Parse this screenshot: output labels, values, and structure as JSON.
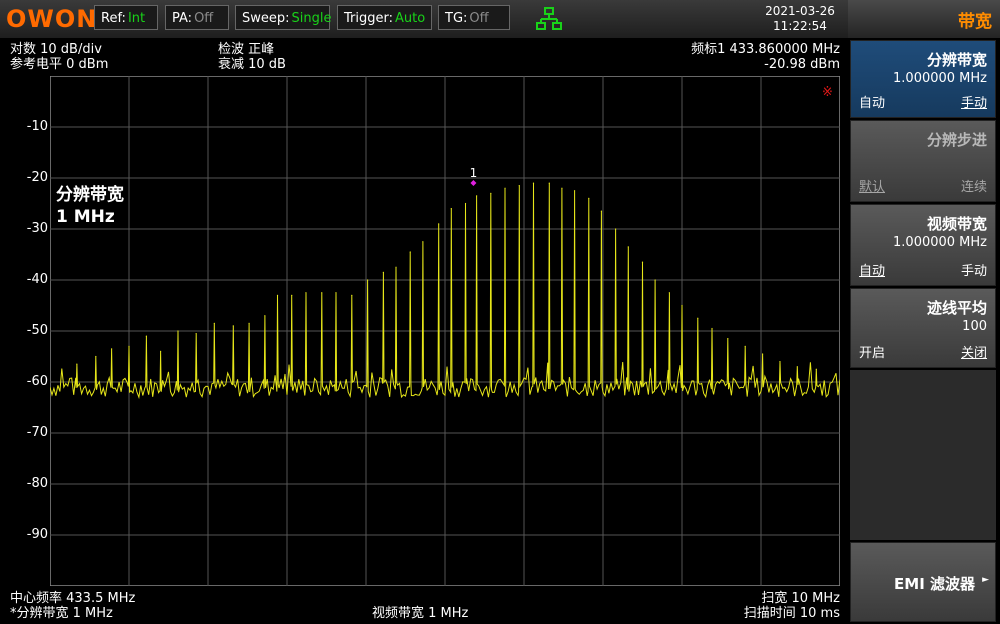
{
  "topbar": {
    "logo": "OWON",
    "ref_key": "Ref:",
    "ref_val": "Int",
    "pa_key": "PA:",
    "pa_val": "Off",
    "sweep_key": "Sweep:",
    "sweep_val": "Single",
    "trigger_key": "Trigger:",
    "trigger_val": "Auto",
    "tg_key": "TG:",
    "tg_val": "Off",
    "network_icon": "network-icon",
    "date": "2021-03-26",
    "time": "11:22:54"
  },
  "menu": {
    "title": "带宽",
    "items": [
      {
        "title": "分辨带宽",
        "value": "1.000000 MHz",
        "left": "自动",
        "right": "手动"
      },
      {
        "title": "分辨步进",
        "value": "",
        "left": "默认",
        "right": "连续"
      },
      {
        "title": "视频带宽",
        "value": "1.000000 MHz",
        "left": "自动",
        "right": "手动"
      },
      {
        "title": "迹线平均",
        "value": "100",
        "left": "开启",
        "right": "关闭"
      }
    ],
    "emi": "EMI 滤波器"
  },
  "info": {
    "scale": "对数 10 dB/div",
    "ref_level": "参考电平 0 dBm",
    "detector": "检波 正峰",
    "atten": "衰减 10 dB",
    "marker_freq": "频标1  433.860000 MHz",
    "marker_amp": "-20.98 dBm",
    "center": "中心频率 433.5 MHz",
    "rbw": "*分辨带宽 1 MHz",
    "vbw": "视频带宽 1 MHz",
    "span": "扫宽 10 MHz",
    "sweep_time": "扫描时间 10 ms",
    "overlay_line1": "分辨带宽",
    "overlay_line2": "1 MHz",
    "marker_label": "1",
    "flag_symbol": "※"
  },
  "colors": {
    "trace": "#e6e619",
    "marker": "#e020e0",
    "accent": "#ff8c00",
    "active_menu": "#1f4c7a"
  },
  "chart_data": {
    "type": "line",
    "ylabel": "dBm",
    "yticks": [
      "-10",
      "-20",
      "-30",
      "-40",
      "-50",
      "-60",
      "-70",
      "-80",
      "-90"
    ],
    "ylim": [
      -100,
      0
    ],
    "xlim": [
      428.5,
      438.5
    ],
    "grid": true,
    "marker": {
      "x": 433.86,
      "y": -20.98
    },
    "series": [
      {
        "noise_floor": -61,
        "peaks": [
          {
            "x": 428.84,
            "y": -56.5
          },
          {
            "x": 429.08,
            "y": -55.0
          },
          {
            "x": 429.28,
            "y": -53.5
          },
          {
            "x": 429.5,
            "y": -53.0
          },
          {
            "x": 429.72,
            "y": -51.0
          },
          {
            "x": 429.9,
            "y": -54.0
          },
          {
            "x": 430.12,
            "y": -50.0
          },
          {
            "x": 430.35,
            "y": -50.5
          },
          {
            "x": 430.58,
            "y": -48.5
          },
          {
            "x": 430.82,
            "y": -49.0
          },
          {
            "x": 431.02,
            "y": -48.5
          },
          {
            "x": 431.22,
            "y": -47.0
          },
          {
            "x": 431.38,
            "y": -43.0
          },
          {
            "x": 431.56,
            "y": -43.0
          },
          {
            "x": 431.74,
            "y": -42.5
          },
          {
            "x": 431.94,
            "y": -42.5
          },
          {
            "x": 432.12,
            "y": -42.5
          },
          {
            "x": 432.32,
            "y": -43.0
          },
          {
            "x": 432.52,
            "y": -40.0
          },
          {
            "x": 432.72,
            "y": -38.5
          },
          {
            "x": 432.88,
            "y": -37.5
          },
          {
            "x": 433.06,
            "y": -34.5
          },
          {
            "x": 433.22,
            "y": -32.5
          },
          {
            "x": 433.42,
            "y": -29.0
          },
          {
            "x": 433.58,
            "y": -26.0
          },
          {
            "x": 433.76,
            "y": -25.0
          },
          {
            "x": 433.9,
            "y": -23.5
          },
          {
            "x": 434.08,
            "y": -23.0
          },
          {
            "x": 434.26,
            "y": -22.0
          },
          {
            "x": 434.44,
            "y": -21.5
          },
          {
            "x": 434.62,
            "y": -21.0
          },
          {
            "x": 434.82,
            "y": -21.0
          },
          {
            "x": 434.98,
            "y": -22.0
          },
          {
            "x": 435.14,
            "y": -22.5
          },
          {
            "x": 435.32,
            "y": -24.0
          },
          {
            "x": 435.48,
            "y": -26.5
          },
          {
            "x": 435.66,
            "y": -30.0
          },
          {
            "x": 435.82,
            "y": -33.5
          },
          {
            "x": 436.0,
            "y": -36.5
          },
          {
            "x": 436.16,
            "y": -40.0
          },
          {
            "x": 436.34,
            "y": -42.5
          },
          {
            "x": 436.5,
            "y": -45.0
          },
          {
            "x": 436.7,
            "y": -47.5
          },
          {
            "x": 436.88,
            "y": -49.5
          },
          {
            "x": 437.08,
            "y": -51.5
          },
          {
            "x": 437.3,
            "y": -53.0
          },
          {
            "x": 437.52,
            "y": -54.5
          },
          {
            "x": 437.74,
            "y": -56.0
          },
          {
            "x": 437.96,
            "y": -57.0
          },
          {
            "x": 438.2,
            "y": -57.5
          }
        ]
      }
    ]
  }
}
